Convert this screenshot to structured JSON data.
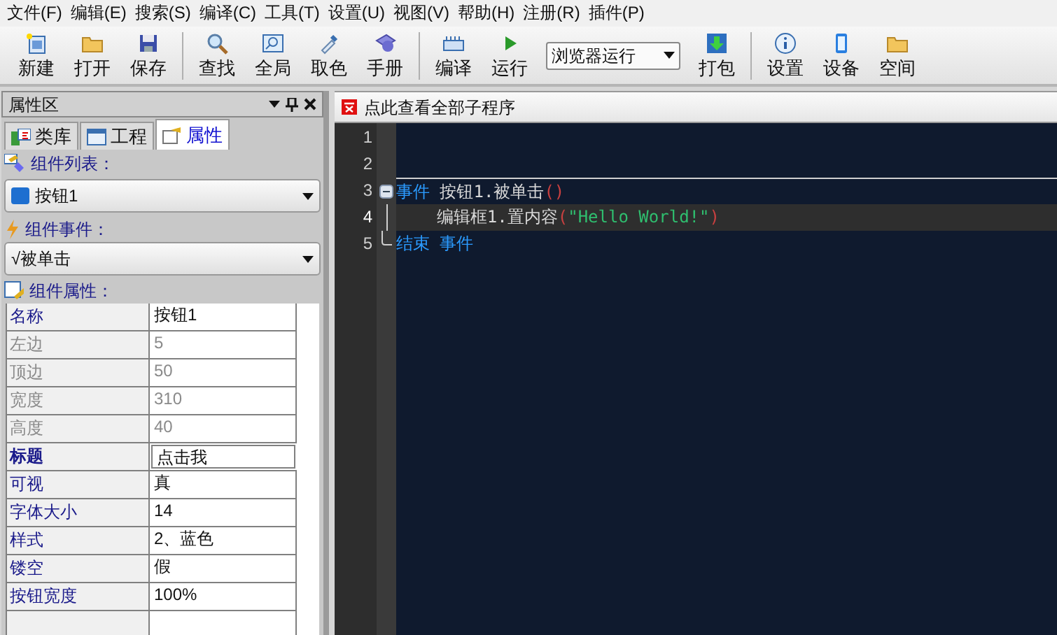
{
  "menu": [
    {
      "label": "文件(F)"
    },
    {
      "label": "编辑(E)"
    },
    {
      "label": "搜索(S)"
    },
    {
      "label": "编译(C)"
    },
    {
      "label": "工具(T)"
    },
    {
      "label": "设置(U)"
    },
    {
      "label": "视图(V)"
    },
    {
      "label": "帮助(H)"
    },
    {
      "label": "注册(R)"
    },
    {
      "label": "插件(P)"
    }
  ],
  "toolbar": [
    {
      "kind": "button",
      "label": "新建"
    },
    {
      "kind": "button",
      "label": "打开"
    },
    {
      "kind": "button",
      "label": "保存"
    },
    {
      "kind": "separator"
    },
    {
      "kind": "button",
      "label": "查找"
    },
    {
      "kind": "button",
      "label": "全局"
    },
    {
      "kind": "button",
      "label": "取色"
    },
    {
      "kind": "button",
      "label": "手册"
    },
    {
      "kind": "separator"
    },
    {
      "kind": "button",
      "label": "编译"
    },
    {
      "kind": "button",
      "label": "运行"
    },
    {
      "kind": "dropdown",
      "value": "浏览器运行"
    },
    {
      "kind": "button",
      "label": "打包"
    },
    {
      "kind": "separator"
    },
    {
      "kind": "button",
      "label": "设置"
    },
    {
      "kind": "button",
      "label": "设备"
    },
    {
      "kind": "button",
      "label": "空间"
    }
  ],
  "panel": {
    "title": "属性区",
    "tabs": [
      {
        "label": "类库",
        "selected": false
      },
      {
        "label": "工程",
        "selected": false
      },
      {
        "label": "属性",
        "selected": true
      }
    ],
    "component_list": {
      "label": "组件列表：",
      "value": "按钮1"
    },
    "component_events": {
      "label": "组件事件：",
      "value": "√被单击"
    },
    "properties": {
      "label": "组件属性：",
      "rows": [
        {
          "name": "名称",
          "value": "按钮1",
          "disabled": false,
          "selected": false
        },
        {
          "name": "左边",
          "value": "5",
          "disabled": true,
          "selected": false
        },
        {
          "name": "顶边",
          "value": "50",
          "disabled": true,
          "selected": false
        },
        {
          "name": "宽度",
          "value": "310",
          "disabled": true,
          "selected": false
        },
        {
          "name": "高度",
          "value": "40",
          "disabled": true,
          "selected": false
        },
        {
          "name": "标题",
          "value": "点击我",
          "disabled": false,
          "selected": true
        },
        {
          "name": "可视",
          "value": "真",
          "disabled": false,
          "selected": false
        },
        {
          "name": "字体大小",
          "value": "14",
          "disabled": false,
          "selected": false
        },
        {
          "name": "样式",
          "value": "2、蓝色",
          "disabled": false,
          "selected": false
        },
        {
          "name": "镂空",
          "value": "假",
          "disabled": false,
          "selected": false
        },
        {
          "name": "按钮宽度",
          "value": "100%",
          "disabled": false,
          "selected": false
        }
      ]
    }
  },
  "editor": {
    "header": "点此查看全部子程序",
    "lines": [
      {
        "number": "1",
        "current": false,
        "kind": "plain"
      },
      {
        "number": "2",
        "current": false,
        "kind": "plain"
      },
      {
        "number": "3",
        "current": false,
        "kind": "block_start",
        "tokens": [
          {
            "kind": "keyword",
            "text": "事件"
          },
          {
            "kind": "plain",
            "text": " 按钮1.被单击"
          },
          {
            "kind": "paren",
            "text": "()"
          }
        ]
      },
      {
        "number": "4",
        "current": true,
        "kind": "block_body",
        "tokens": [
          {
            "kind": "plain",
            "text": "    编辑框1.置内容"
          },
          {
            "kind": "paren",
            "text": "("
          },
          {
            "kind": "string",
            "text": "\"Hello World!\""
          },
          {
            "kind": "paren",
            "text": ")"
          }
        ]
      },
      {
        "number": "5",
        "current": false,
        "kind": "block_end",
        "tokens": [
          {
            "kind": "keyword",
            "text": "结束 事件"
          }
        ]
      }
    ]
  }
}
